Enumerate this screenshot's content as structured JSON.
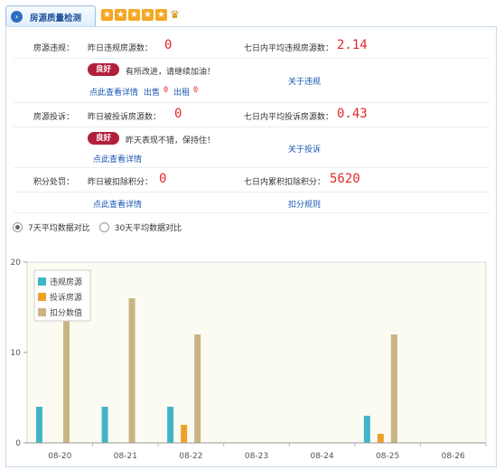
{
  "header": {
    "tab_icon": "arrow-right-icon",
    "tab_title": "房源质量检测",
    "star_rating": 5,
    "medal_icon": "crown-medal-icon"
  },
  "violation": {
    "label": "房源违规：",
    "yesterday_label": "昨日违规房源数：",
    "yesterday_value": "0",
    "avg_label": "七日内平均违规房源数：",
    "avg_value": "2.14",
    "badge": "良好",
    "message": "有所改进，请继续加油！",
    "detail_link": "点此查看详情",
    "sale_label": "出售",
    "sale_value": "0",
    "rent_label": "出租",
    "rent_value": "0",
    "about_link": "关于违规"
  },
  "complaint": {
    "label": "房源投诉：",
    "yesterday_label": "昨日被投诉房源数：",
    "yesterday_value": "0",
    "avg_label": "七日内平均投诉房源数：",
    "avg_value": "0.43",
    "badge": "良好",
    "message": "昨天表现不错，保持住！",
    "detail_link": "点此查看详情",
    "about_link": "关于投诉"
  },
  "points": {
    "label": "积分处罚：",
    "yesterday_label": "昨日被扣除积分：",
    "yesterday_value": "0",
    "total_label": "七日内累积扣除积分：",
    "total_value": "5620",
    "detail_link": "点此查看详情",
    "rules_link": "扣分规则"
  },
  "compare": {
    "option_7": "7天平均数据对比",
    "option_30": "30天平均数据对比",
    "selected": "7天平均数据对比"
  },
  "colors": {
    "violation": "#41b5c8",
    "complaint": "#eea12a",
    "points": "#c8b582",
    "plot_bg": "#fcfbf2"
  },
  "chart_data": {
    "type": "bar",
    "categories": [
      "08-20",
      "08-21",
      "08-22",
      "08-23",
      "08-24",
      "08-25",
      "08-26"
    ],
    "series": [
      {
        "name": "违规房源",
        "values": [
          4,
          4,
          4,
          0,
          0,
          3,
          0
        ]
      },
      {
        "name": "投诉房源",
        "values": [
          0,
          0,
          2,
          0,
          0,
          1,
          0
        ]
      },
      {
        "name": "扣分数值",
        "values": [
          16,
          16,
          12,
          0,
          0,
          12,
          0
        ]
      }
    ],
    "yticks": [
      "0",
      "10",
      "20"
    ],
    "ylim": [
      0,
      20
    ],
    "legend_position": "top-left",
    "grid": false
  }
}
